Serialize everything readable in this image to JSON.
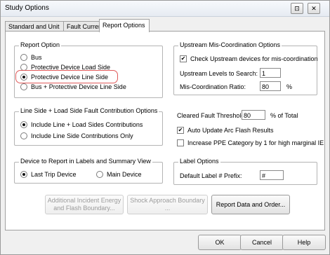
{
  "window": {
    "title": "Study Options",
    "help_icon": "⊡",
    "close_icon": "✕"
  },
  "tabs": [
    {
      "label": "Standard and Unit"
    },
    {
      "label": "Fault Current"
    },
    {
      "label": "Report Options"
    }
  ],
  "report_option": {
    "legend": "Report Option",
    "items": [
      {
        "label": "Bus",
        "selected": false
      },
      {
        "label": "Protective Device Load Side",
        "selected": false
      },
      {
        "label": "Protective Device Line Side",
        "selected": true
      },
      {
        "label": "Bus + Protective Device Line Side",
        "selected": false
      }
    ]
  },
  "upstream": {
    "legend": "Upstream Mis-Coordination Options",
    "check_label": "Check Upstream devices for mis-coordination",
    "check_mark": "✔",
    "levels_label": "Upstream Levels to Search:",
    "levels_value": "1",
    "ratio_label": "Mis-Coordination Ratio:",
    "ratio_value": "80",
    "ratio_unit": "%"
  },
  "contribution": {
    "legend": "Line Side + Load Side Fault Contribution Options",
    "items": [
      {
        "label": "Include Line + Load Sides Contributions",
        "selected": true
      },
      {
        "label": "Include Line Side Contributions Only",
        "selected": false
      }
    ]
  },
  "fault_threshold": {
    "label": "Cleared Fault Threshold:",
    "value": "80",
    "unit": "% of Total"
  },
  "auto_update": {
    "label": "Auto Update Arc Flash Results",
    "checked": true,
    "mark": "✔"
  },
  "increase_ppe": {
    "label": "Increase PPE Category by 1 for high marginal IE",
    "checked": false
  },
  "device_report": {
    "legend": "Device to Report in Labels and Summary View",
    "items": [
      {
        "label": "Last Trip Device",
        "selected": true
      },
      {
        "label": "Main Device",
        "selected": false
      }
    ]
  },
  "label_options": {
    "legend": "Label Options",
    "prefix_label": "Default Label # Prefix:",
    "prefix_value": "#"
  },
  "buttons": {
    "incident": "Additional Incident Energy and Flash Boundary...",
    "shock": "Shock Approach Boundary ...",
    "report": "Report Data and Order..."
  },
  "dialog_buttons": {
    "ok": "OK",
    "cancel": "Cancel",
    "help": "Help"
  },
  "colors": {
    "highlight": "#e05a5a"
  }
}
